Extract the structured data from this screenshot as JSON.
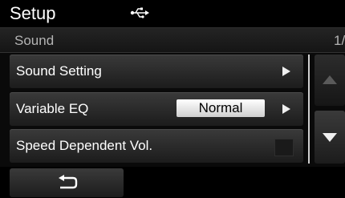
{
  "header": {
    "title": "Setup",
    "icon": "usb-icon"
  },
  "subheader": {
    "title": "Sound",
    "page_indicator": "1/"
  },
  "menu": {
    "items": [
      {
        "label": "Sound Setting",
        "icon": "chevron-right-icon"
      },
      {
        "label": "Variable EQ",
        "value": "Normal",
        "icon": "chevron-right-icon"
      },
      {
        "label": "Speed Dependent Vol.",
        "checked": false
      }
    ]
  },
  "scroll": {
    "up_icon": "scroll-up-icon",
    "down_icon": "scroll-down-icon"
  },
  "footer": {
    "back_icon": "back-arrow-icon"
  },
  "colors": {
    "background": "#0a0a0a",
    "text": "#ffffff",
    "subtext": "#b4b4b4",
    "value_box": "#ffffff"
  }
}
